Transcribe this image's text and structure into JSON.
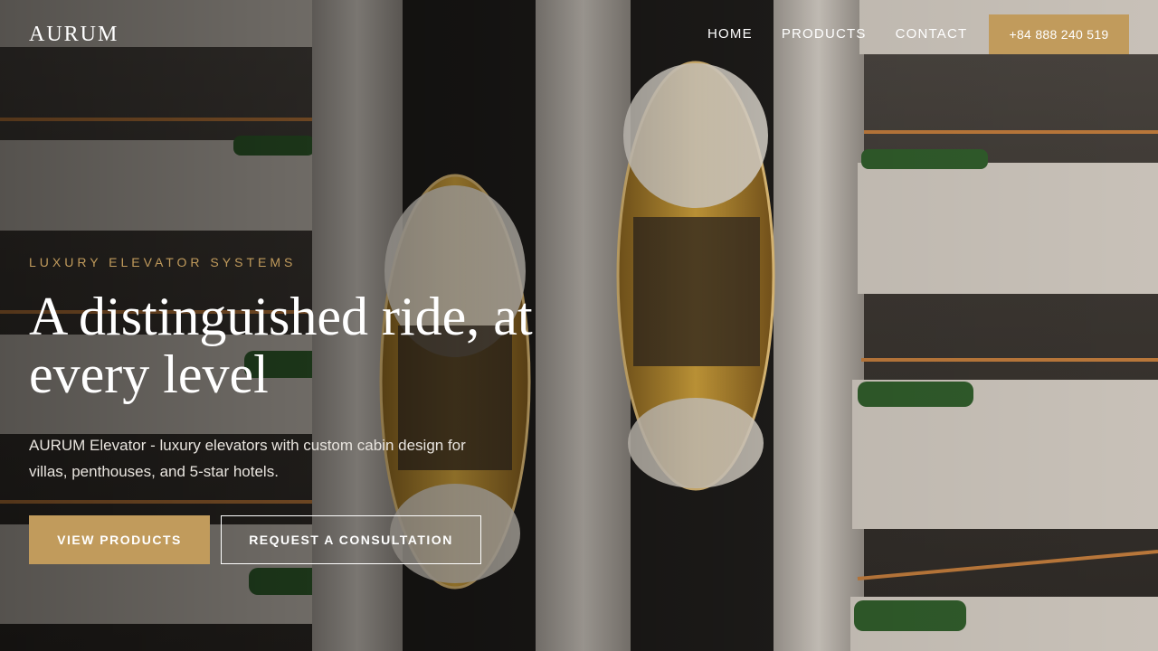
{
  "header": {
    "logo": "AURUM",
    "nav": [
      {
        "label": "HOME"
      },
      {
        "label": "PRODUCTS"
      },
      {
        "label": "CONTACT"
      }
    ],
    "phone": "+84 888 240 519"
  },
  "hero": {
    "eyebrow": "LUXURY ELEVATOR SYSTEMS",
    "headline": "A distinguished ride, at every level",
    "subtext": "AURUM Elevator - luxury elevators with custom cabin design for villas, penthouses, and 5-star hotels.",
    "primary_cta": "VIEW PRODUCTS",
    "secondary_cta": "REQUEST A CONSULTATION"
  },
  "colors": {
    "accent": "#c19b5c",
    "text": "#ffffff"
  }
}
